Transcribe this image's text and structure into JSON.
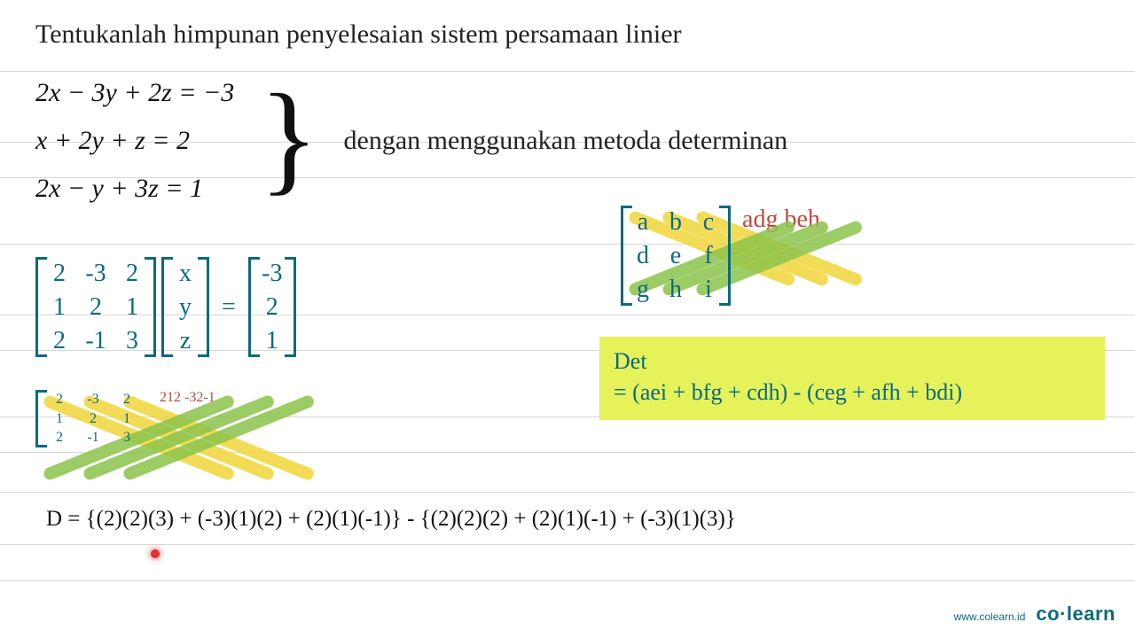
{
  "title": "Tentukanlah himpunan penyelesaian sistem persamaan linier",
  "equations": {
    "eq1": "2x − 3y + 2z = −3",
    "eq2": "x + 2y + z = 2",
    "eq3": "2x − y + 3z = 1"
  },
  "method_text": "dengan menggunakan metoda determinan",
  "matrix_equation": {
    "A": [
      [
        "2",
        "-3",
        "2"
      ],
      [
        "1",
        "2",
        "1"
      ],
      [
        "2",
        "-1",
        "3"
      ]
    ],
    "vars": [
      "x",
      "y",
      "z"
    ],
    "b": [
      "-3",
      "2",
      "1"
    ],
    "equals": "="
  },
  "sarrus_main": {
    "base": [
      [
        "2",
        "-3",
        "2"
      ],
      [
        "1",
        "2",
        "1"
      ],
      [
        "2",
        "-1",
        "3"
      ]
    ],
    "ext": [
      [
        "2",
        "-3"
      ],
      [
        "1",
        "2"
      ],
      [
        "2",
        "-1"
      ]
    ]
  },
  "sarrus_ref": {
    "base": [
      [
        "a",
        "b",
        "c"
      ],
      [
        "d",
        "e",
        "f"
      ],
      [
        "g",
        "h",
        "i"
      ]
    ],
    "ext": [
      [
        "a",
        "b"
      ],
      [
        "d",
        "e"
      ],
      [
        "g",
        "h"
      ]
    ]
  },
  "det_box": {
    "line1": "Det",
    "line2": "= (aei + bfg + cdh) - (ceg + afh + bdi)"
  },
  "d_expression": "D = {(2)(2)(3) + (-3)(1)(2) + (2)(1)(-1)} - {(2)(2)(2) + (2)(1)(-1) + (-3)(1)(3)}",
  "branding": {
    "url": "www.colearn.id",
    "logo_left": "co",
    "logo_sep": "·",
    "logo_right": "learn"
  },
  "colors": {
    "teal": "#0b6a7f",
    "red": "#c0483e",
    "highlight": "#e5f25a",
    "green_stroke": "#8bc34a",
    "yellow_stroke": "#f0d63a"
  }
}
